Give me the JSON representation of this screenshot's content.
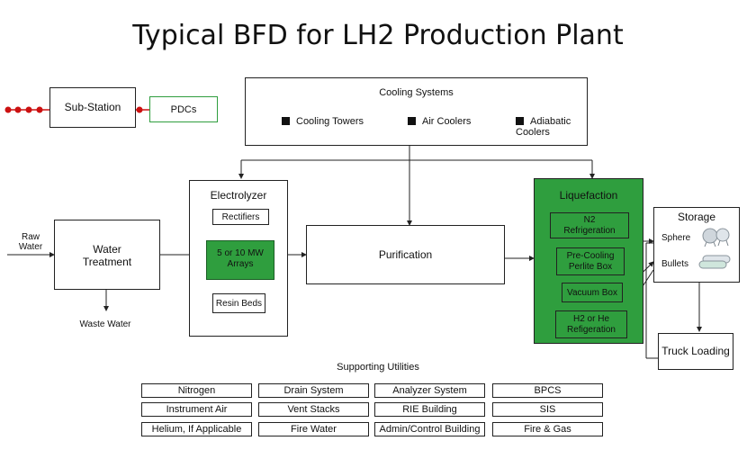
{
  "title": "Typical BFD for LH2 Production Plant",
  "substation": {
    "label": "Sub-Station",
    "pdcs": "PDCs"
  },
  "cooling": {
    "title": "Cooling Systems",
    "items": [
      "Cooling Towers",
      "Air Coolers",
      "Adiabatic Coolers"
    ]
  },
  "inputs": {
    "raw_water_line1": "Raw",
    "raw_water_line2": "Water",
    "waste_water": "Waste Water"
  },
  "water_treatment": {
    "line1": "Water",
    "line2": "Treatment"
  },
  "electrolyzer": {
    "title": "Electrolyzer",
    "rectifiers": "Rectifiers",
    "arrays_line1": "5 or 10 MW",
    "arrays_line2": "Arrays",
    "resin_beds": "Resin Beds"
  },
  "purification": "Purification",
  "liquefaction": {
    "title": "Liquefaction",
    "n2_line1": "N2",
    "n2_line2": "Refrigeration",
    "precool_line1": "Pre-Cooling",
    "precool_line2": "Perlite Box",
    "vacuum_box": "Vacuum Box",
    "h2_line1": "H2 or He",
    "h2_line2": "Refigeration"
  },
  "storage": {
    "title": "Storage",
    "sphere": "Sphere",
    "bullets": "Bullets"
  },
  "truck_loading": "Truck Loading",
  "supporting_utilities": {
    "title": "Supporting Utilities",
    "rows": [
      [
        "Nitrogen",
        "Drain System",
        "Analyzer System",
        "BPCS"
      ],
      [
        "Instrument Air",
        "Vent Stacks",
        "RIE Building",
        "SIS"
      ],
      [
        "Helium, If Applicable",
        "Fire Water",
        "Admin/Control Building",
        "Fire & Gas"
      ]
    ]
  },
  "colors": {
    "green": "#2f9e3e",
    "red_dot": "#cc1111",
    "pdc_border": "#2f9e3e"
  }
}
